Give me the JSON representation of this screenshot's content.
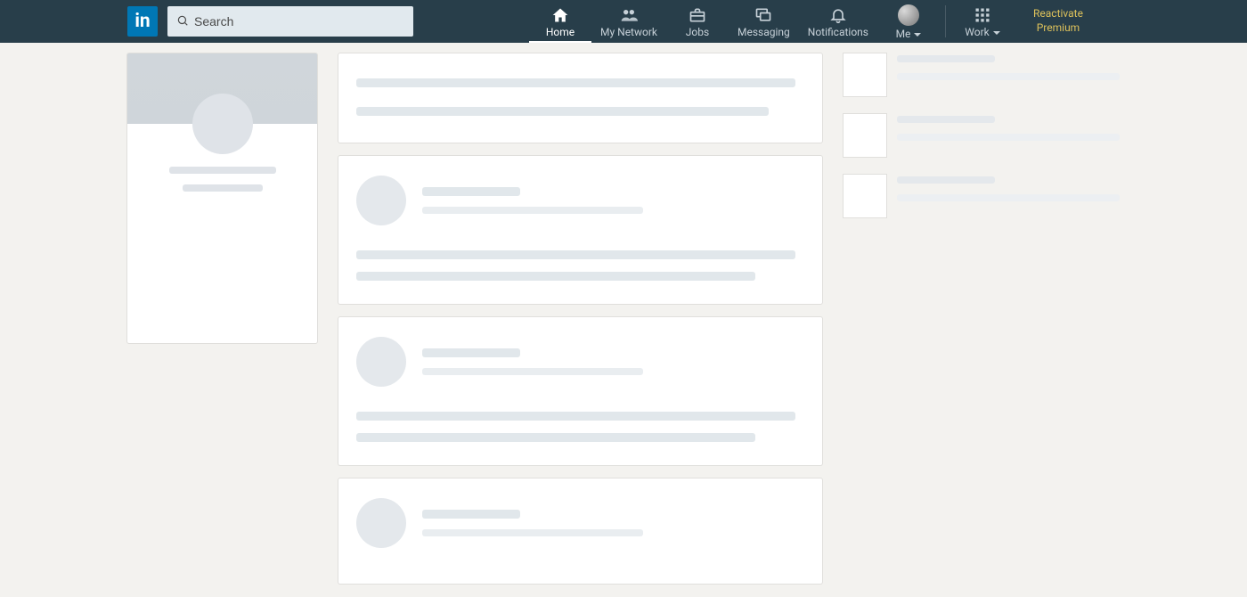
{
  "header": {
    "logo_text": "in",
    "search_placeholder": "Search",
    "nav": {
      "home": "Home",
      "network": "My Network",
      "jobs": "Jobs",
      "messaging": "Messaging",
      "notifications": "Notifications",
      "me": "Me",
      "work": "Work"
    },
    "premium_line1": "Reactivate",
    "premium_line2": "Premium"
  }
}
